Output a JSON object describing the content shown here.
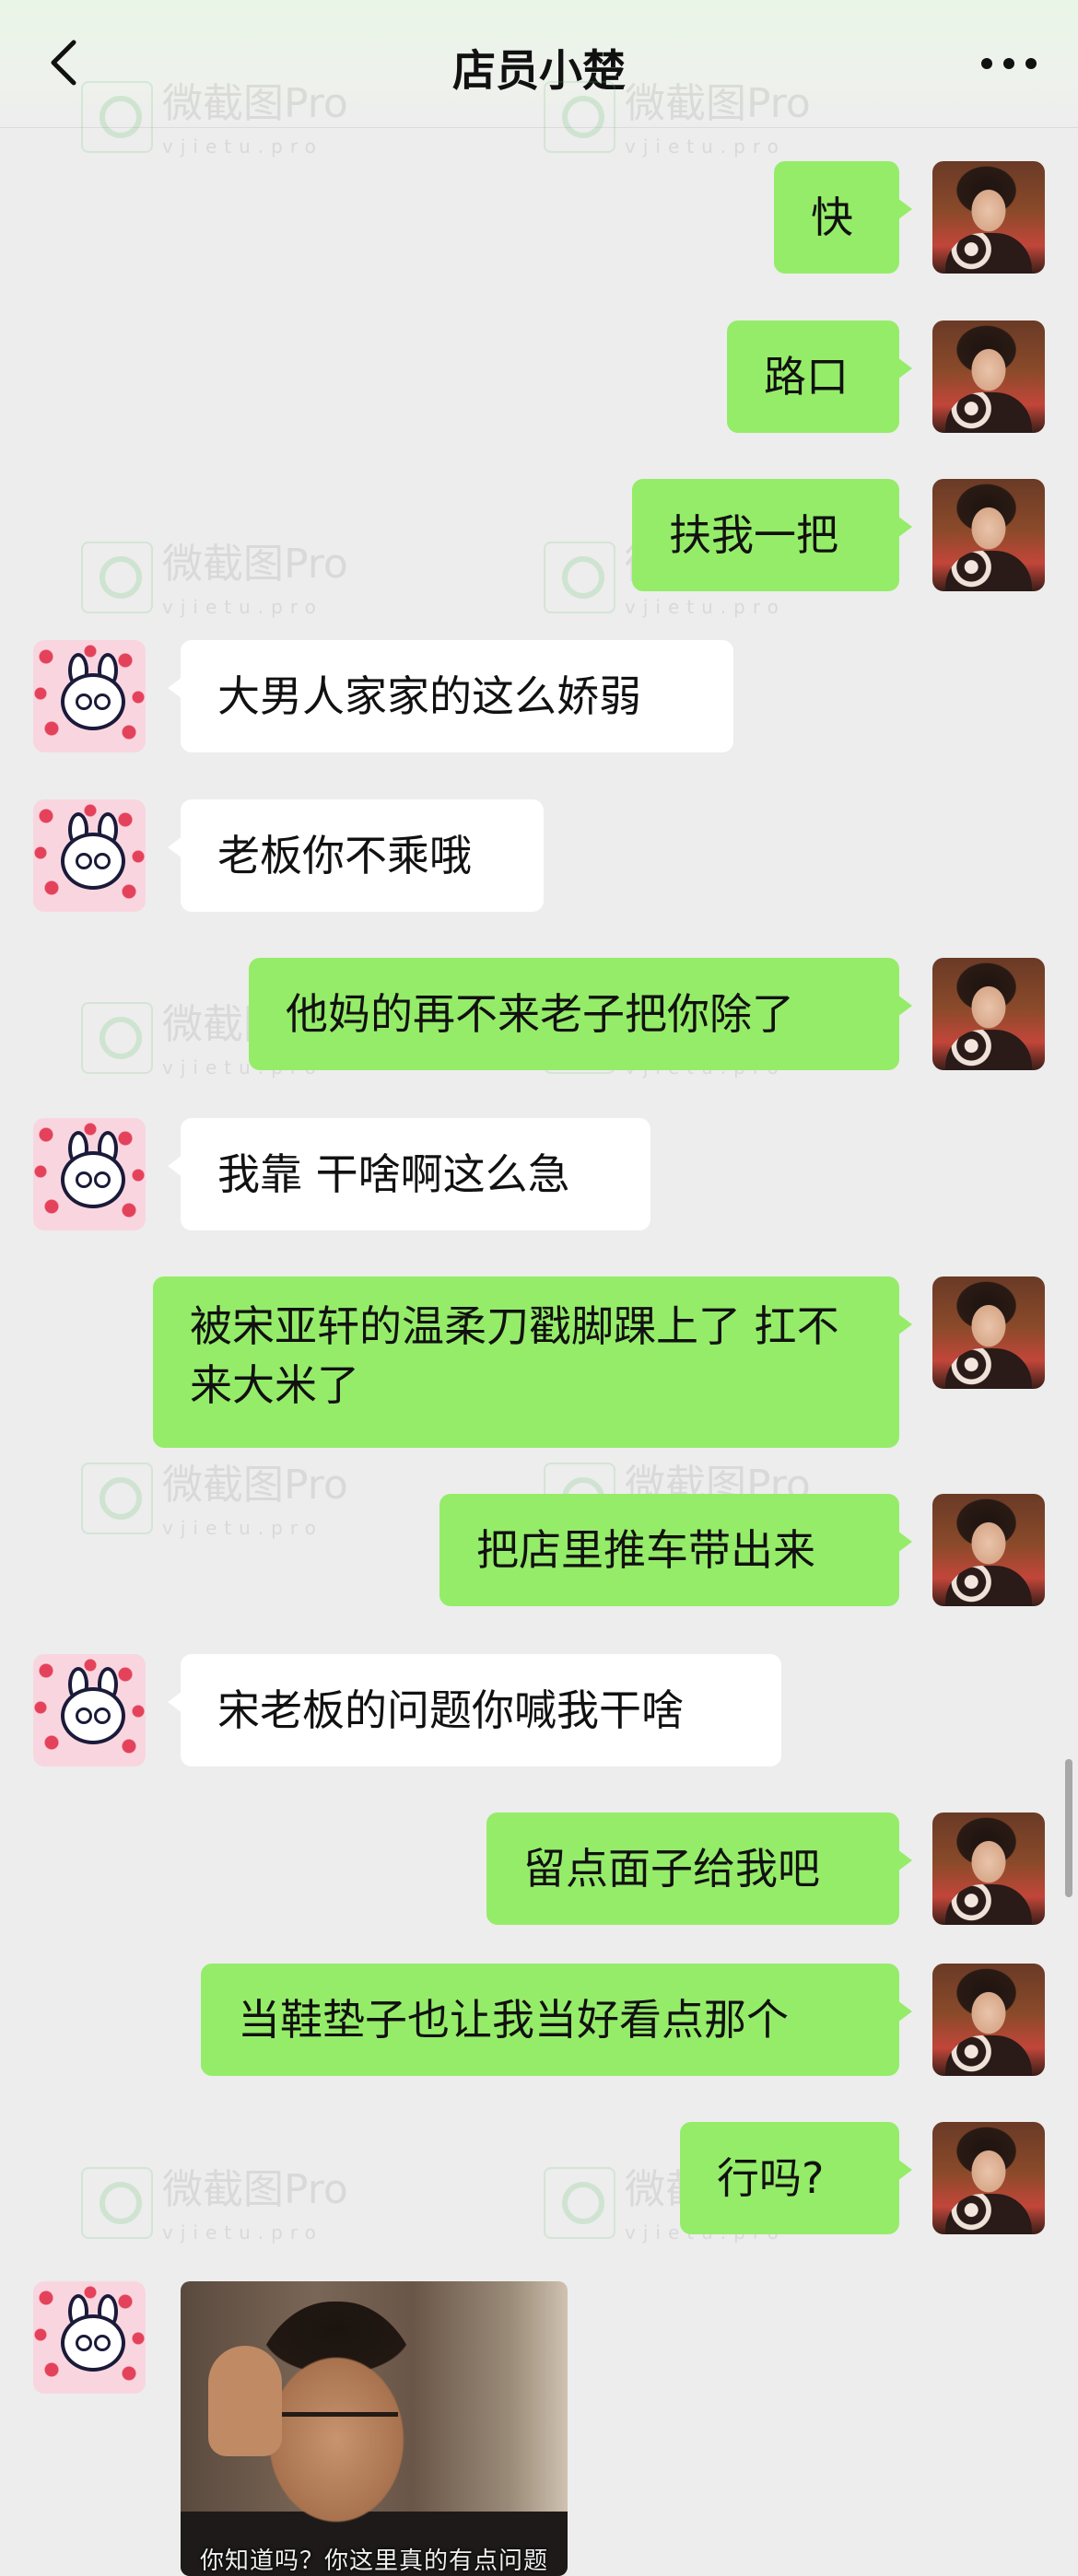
{
  "header": {
    "title": "店员小楚"
  },
  "watermark": {
    "text": "微截图Pro",
    "sub": "vjietu.pro"
  },
  "messages": [
    {
      "side": "me",
      "text": "快"
    },
    {
      "side": "me",
      "text": "路口"
    },
    {
      "side": "me",
      "text": "扶我一把"
    },
    {
      "side": "other",
      "text": "大男人家家的这么娇弱"
    },
    {
      "side": "other",
      "text": "老板你不乘哦"
    },
    {
      "side": "me",
      "text": "他妈的再不来老子把你除了"
    },
    {
      "side": "other",
      "text": "我靠 干啥啊这么急"
    },
    {
      "side": "me",
      "text": "被宋亚轩的温柔刀戳脚踝上了 扛不来大米了"
    },
    {
      "side": "me",
      "text": "把店里推车带出来"
    },
    {
      "side": "other",
      "text": "宋老板的问题你喊我干啥"
    },
    {
      "side": "me",
      "text": "留点面子给我吧"
    },
    {
      "side": "me",
      "text": "当鞋垫子也让我当好看点那个"
    },
    {
      "side": "me",
      "text": "行吗?"
    },
    {
      "side": "other",
      "type": "image",
      "caption": "你知道吗？你这里真的有点问题"
    }
  ],
  "colors": {
    "my_bubble": "#95ec69",
    "their_bubble": "#ffffff",
    "background": "#ededed"
  },
  "icons": {
    "back": "chevron-left-icon",
    "more": "more-dots-icon"
  }
}
